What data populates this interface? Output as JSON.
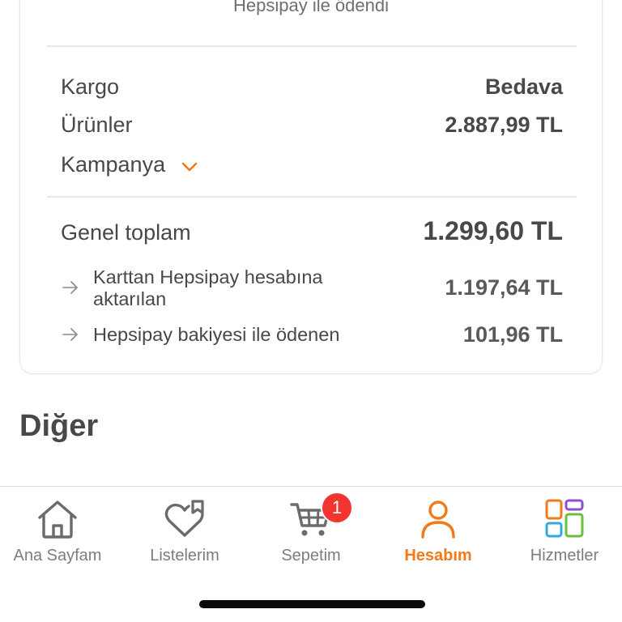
{
  "payment_note": "Hepsipay ile ödendi",
  "summary": {
    "shipping_label": "Kargo",
    "shipping_value": "Bedava",
    "products_label": "Ürünler",
    "products_value": "2.887,99 TL",
    "campaign_label": "Kampanya",
    "total_label": "Genel toplam",
    "total_value": "1.299,60 TL",
    "card_transfer_label": "Karttan Hepsipay hesabına aktarılan",
    "card_transfer_value": "1.197,64 TL",
    "balance_paid_label": "Hepsipay bakiyesi ile ödenen",
    "balance_paid_value": "101,96 TL"
  },
  "section": {
    "other_title": "Diğer"
  },
  "tabbar": {
    "home": "Ana Sayfam",
    "lists": "Listelerim",
    "cart": "Sepetim",
    "cart_badge": "1",
    "account": "Hesabım",
    "services": "Hizmetler"
  },
  "colors": {
    "accent": "#f27a1a",
    "badge": "#f2352f",
    "text": "#484848",
    "icon_gray": "#6b6b6b"
  }
}
